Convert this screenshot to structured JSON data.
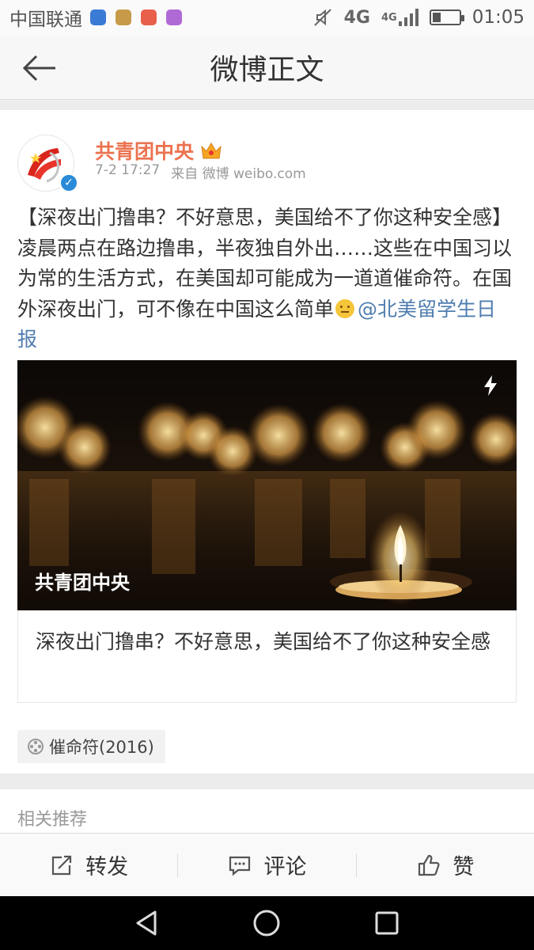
{
  "status_bar": {
    "carrier": "中国联通",
    "network": "4G",
    "network2": "4G",
    "time": "01:05"
  },
  "navbar": {
    "title": "微博正文"
  },
  "post": {
    "author": "共青团中央",
    "time": "7-2 17:27",
    "source": "来自 微博 weibo.com",
    "text_main": "【深夜出门撸串？不好意思，美国给不了你这种安全感】凌晨两点在路边撸串，半夜独自外出……这些在中国习以为常的生活方式，在美国却可能成为一道道催命符。在国外深夜出门，可不像在中国这么简单",
    "mention": "@北美留学生日报",
    "media_caption": "共青团中央",
    "link_title": "深夜出门撸串？不好意思，美国给不了你这种安全感",
    "topic": "催命符(2016)"
  },
  "related": {
    "label": "相关推荐"
  },
  "actions": {
    "repost": "转发",
    "comment": "评论",
    "like": "赞"
  },
  "colors": {
    "author": "#eb7350",
    "link": "#507daf",
    "verified": "#2a8ad8"
  }
}
